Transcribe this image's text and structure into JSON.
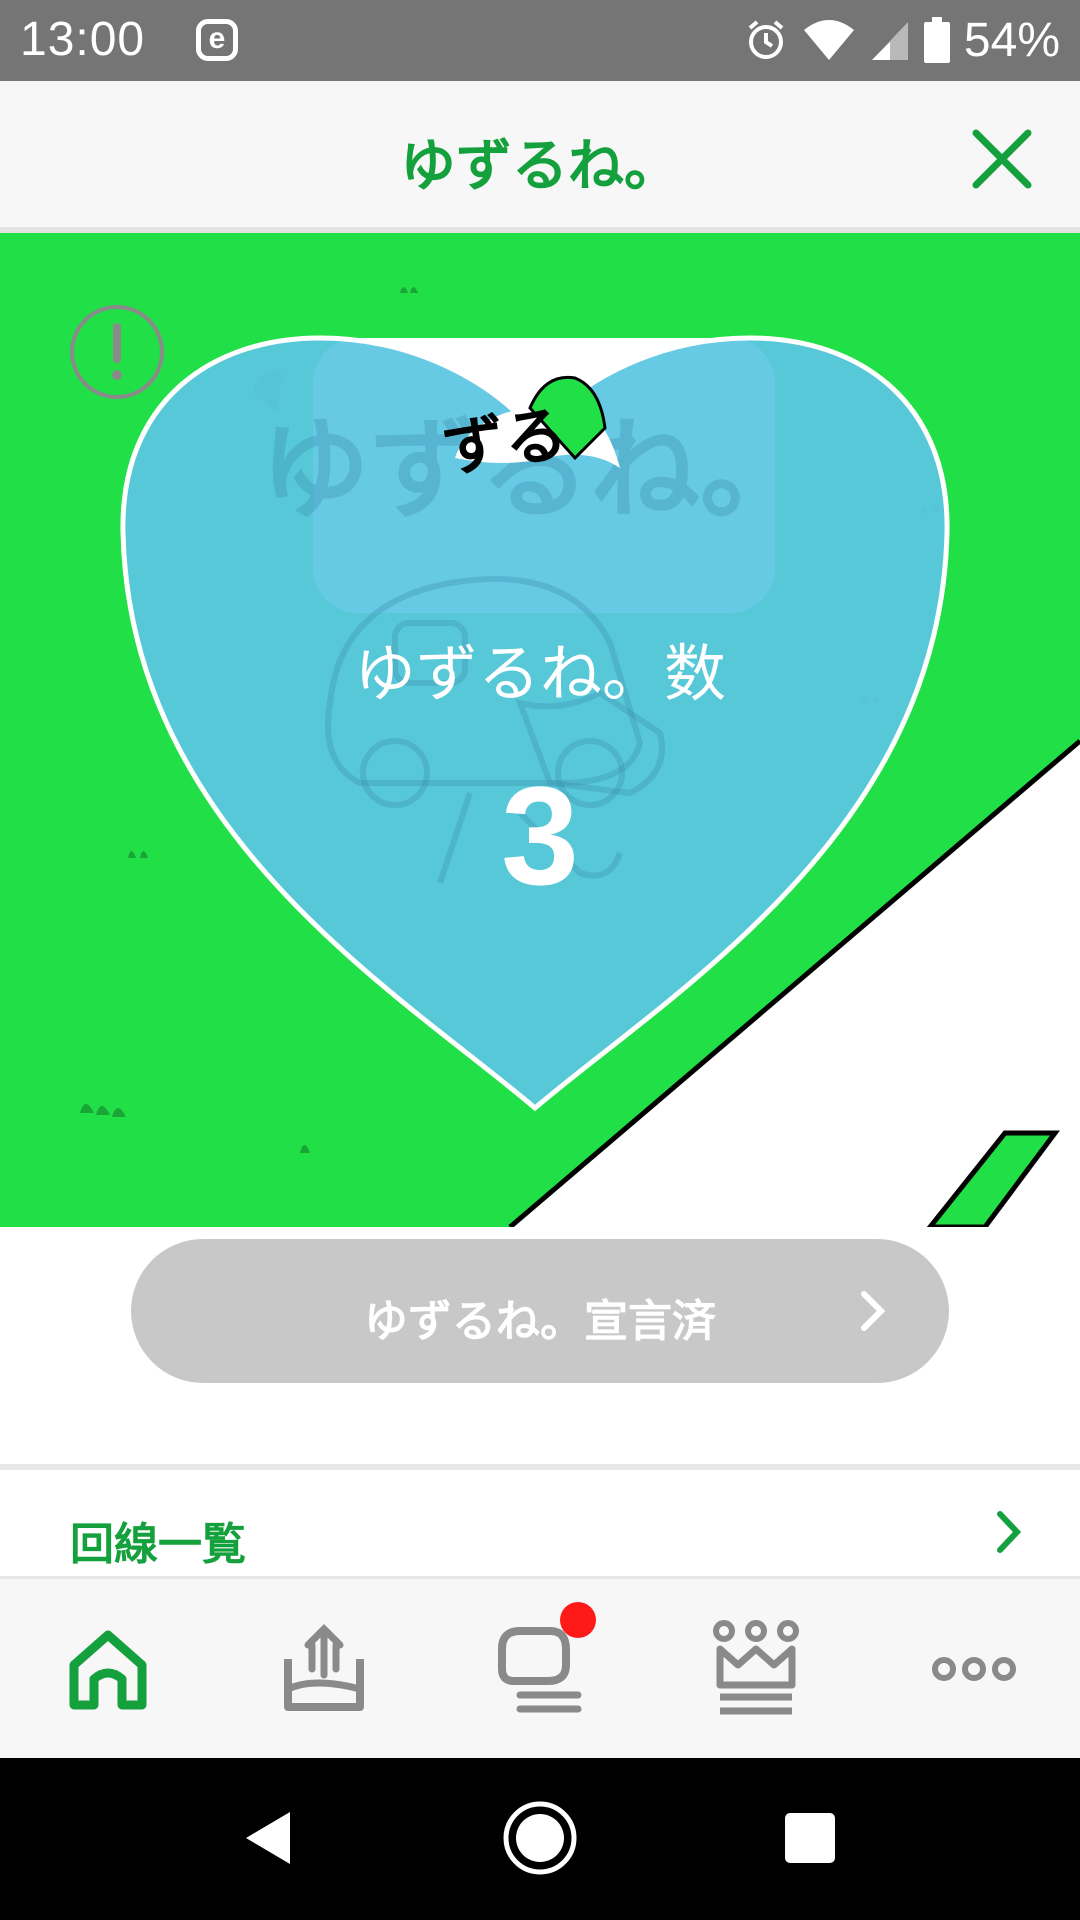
{
  "status_bar": {
    "time": "13:00",
    "e_icon": "e",
    "battery_percent": "54%"
  },
  "header": {
    "title": "ゆずるね。"
  },
  "hero": {
    "heart_title": "ゆずるね。数",
    "count": "3",
    "logo_text": "ゆずるね。",
    "sticker_text": "ずる"
  },
  "declare_button": {
    "label": "ゆずるね。宣言済"
  },
  "lines_row": {
    "label": "回線一覧"
  },
  "tabbar": {
    "tabs": [
      "home-icon",
      "upload-icon",
      "chat-icon",
      "crown-icon",
      "more-icon"
    ]
  },
  "colors": {
    "brand_green": "#14a03c",
    "hero_green": "#21df47",
    "heart_blue": "#5bc6e3",
    "badge_red": "#ff1a1a"
  }
}
